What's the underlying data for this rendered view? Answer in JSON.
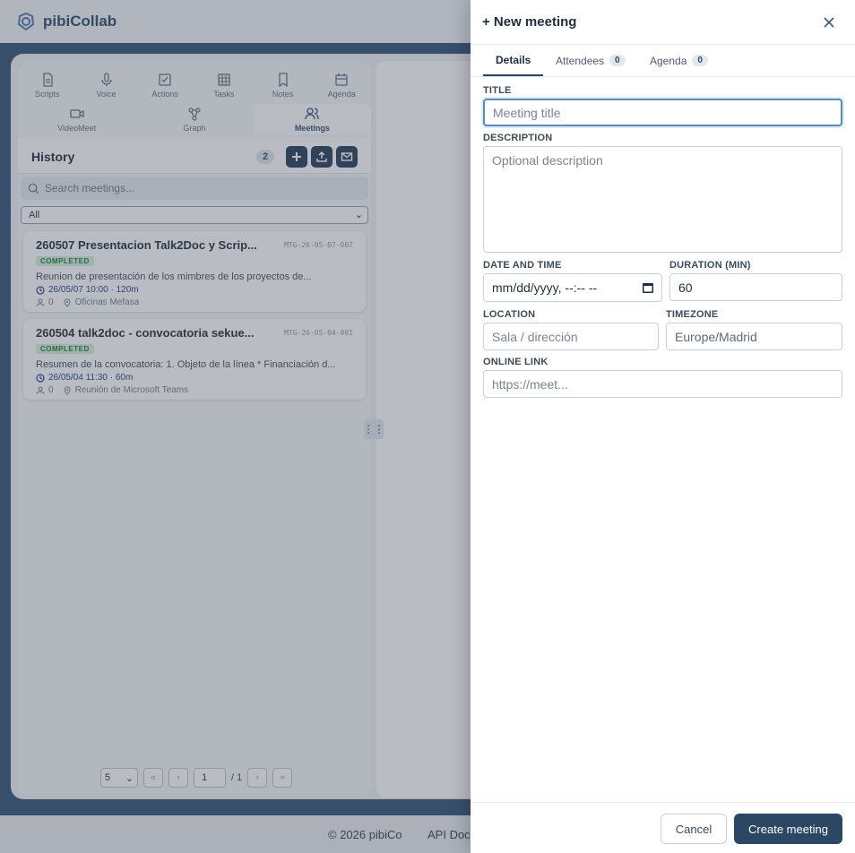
{
  "app": {
    "name": "pibiCollab"
  },
  "nav": {
    "row1": [
      {
        "label": "Scripts",
        "icon": "file-icon"
      },
      {
        "label": "Voice",
        "icon": "mic-icon"
      },
      {
        "label": "Actions",
        "icon": "checkbox-icon"
      },
      {
        "label": "Tasks",
        "icon": "grid-icon"
      },
      {
        "label": "Notes",
        "icon": "bookmark-icon"
      },
      {
        "label": "Agenda",
        "icon": "calendar-icon"
      }
    ],
    "row2": [
      {
        "label": "VideoMeet",
        "icon": "video-icon"
      },
      {
        "label": "Graph",
        "icon": "graph-icon"
      },
      {
        "label": "Meetings",
        "icon": "users-icon",
        "active": true
      }
    ]
  },
  "history": {
    "title": "History",
    "count": "2",
    "search_placeholder": "Search meetings...",
    "filter_value": "All",
    "meetings": [
      {
        "title": "260507 Presentacion Talk2Doc y Scrip...",
        "id": "MTG-26-05-07-007",
        "status": "COMPLETED",
        "description": "Reunion de presentación de los mimbres de los proyectos de...",
        "datetime": "26/05/07 10:00 · 120m",
        "attendees": "0",
        "location": "Oficinas Mefasa"
      },
      {
        "title": "260504 talk2doc - convocatoria sekue...",
        "id": "MTG-26-05-04-001",
        "status": "COMPLETED",
        "description": "Resumen de la convocatoria: 1. Objeto de la línea * Financiación d...",
        "datetime": "26/05/04 11:30 · 60m",
        "attendees": "0",
        "location": "Reunión de Microsoft Teams"
      }
    ],
    "pager": {
      "page_size": "5",
      "page": "1",
      "total": "/ 1",
      "first": "«",
      "prev": "‹",
      "next": "›",
      "last": "»"
    }
  },
  "footer": {
    "copyright": "© 2026 pibiCo",
    "api": "API Doc"
  },
  "drawer": {
    "title": "+ New meeting",
    "tabs": [
      {
        "label": "Details",
        "count": ""
      },
      {
        "label": "Attendees",
        "count": "0"
      },
      {
        "label": "Agenda",
        "count": "0"
      }
    ],
    "fields": {
      "title_label": "TITLE",
      "title_placeholder": "Meeting title",
      "description_label": "DESCRIPTION",
      "description_placeholder": "Optional description",
      "datetime_label": "DATE AND TIME",
      "datetime_value": "mm/dd/yyyy, --:-- --",
      "duration_label": "DURATION (MIN)",
      "duration_value": "60",
      "location_label": "LOCATION",
      "location_placeholder": "Sala / dirección",
      "timezone_label": "TIMEZONE",
      "timezone_value": "Europe/Madrid",
      "online_label": "ONLINE LINK",
      "online_placeholder": "https://meet..."
    },
    "buttons": {
      "cancel": "Cancel",
      "create": "Create meeting"
    }
  }
}
